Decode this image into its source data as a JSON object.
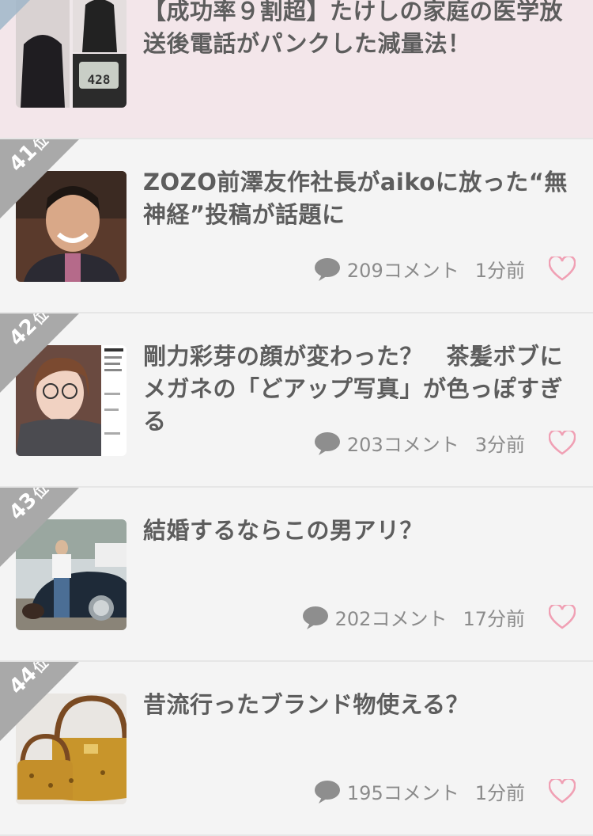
{
  "items": [
    {
      "rank": "",
      "title": "【成功率９割超】たけしの家庭の医学放送後電話がパンクした減量法！",
      "scale_reading": "428",
      "highlight": true
    },
    {
      "rank": "41",
      "rank_suffix": "位",
      "title": "ZOZO前澤友作社長がaikoに放った“無神経”投稿が話題に",
      "comments": "209コメント",
      "time": "1分前"
    },
    {
      "rank": "42",
      "rank_suffix": "位",
      "title": "剛力彩芽の顔が変わった？　茶髪ボブにメガネの「どアップ写真」が色っぽすぎる",
      "comments": "203コメント",
      "time": "3分前"
    },
    {
      "rank": "43",
      "rank_suffix": "位",
      "title": "結婚するならこの男アリ？",
      "comments": "202コメント",
      "time": "17分前"
    },
    {
      "rank": "44",
      "rank_suffix": "位",
      "title": "昔流行ったブランド物使える？",
      "comments": "195コメント",
      "time": "1分前"
    }
  ],
  "icons": {
    "comment": "comment-bubble-icon",
    "like": "heart-icon"
  },
  "colors": {
    "highlight_bg": "#f3e6ea",
    "ribbon": "#a9a9a9",
    "first_ribbon": "#9fb6c9",
    "heart": "#f0a0b4",
    "bubble": "#8e8e8e"
  }
}
